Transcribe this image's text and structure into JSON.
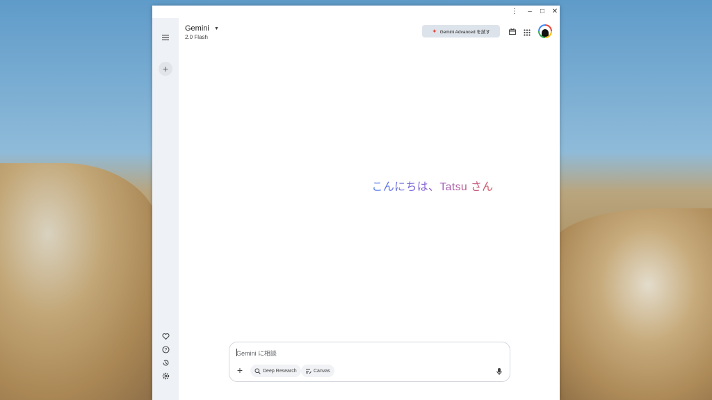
{
  "window": {
    "controls": {
      "menu": "⋮",
      "minimize": "–",
      "maximize": "□",
      "close": "✕"
    }
  },
  "header": {
    "title": "Gemini",
    "model": "2.0 Flash",
    "advanced_button": "Gemini Advanced を試す"
  },
  "sidebar": {
    "new_chat_symbol": "+"
  },
  "main": {
    "greeting": "こんにちは、Tatsu さん"
  },
  "input": {
    "placeholder": "Gemini に相談",
    "plus_symbol": "+",
    "chips": [
      {
        "label": "Deep Research",
        "icon": "deep-research-icon"
      },
      {
        "label": "Canvas",
        "icon": "canvas-icon"
      }
    ]
  },
  "colors": {
    "accent_star": "#e0473c",
    "greeting_gradient": [
      "#4f7ae8",
      "#8a63d2",
      "#d9555f"
    ],
    "sidebar_bg": "#eef1f6"
  }
}
